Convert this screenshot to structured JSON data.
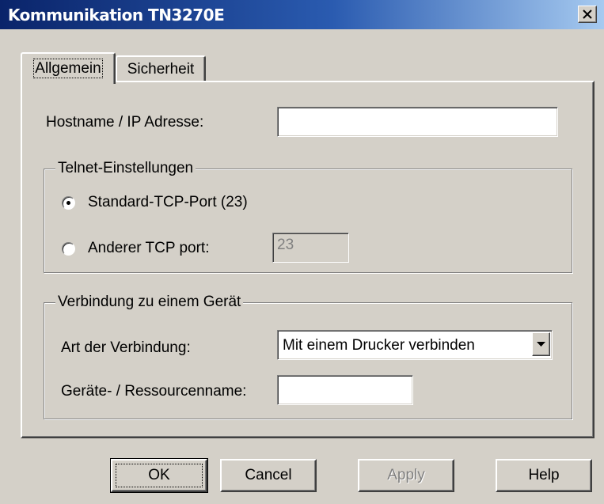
{
  "window": {
    "title": "Kommunikation TN3270E",
    "close_icon": "close-x-icon"
  },
  "tabs": [
    {
      "label": "Allgemein",
      "active": true
    },
    {
      "label": "Sicherheit",
      "active": false
    }
  ],
  "hostname": {
    "label": "Hostname / IP Adresse:",
    "value": ""
  },
  "telnet": {
    "legend": "Telnet-Einstellungen",
    "standard_port_label": "Standard-TCP-Port (23)",
    "standard_port_selected": true,
    "other_port_label": "Anderer TCP port:",
    "other_port_selected": false,
    "other_port_value": "23"
  },
  "device": {
    "legend": "Verbindung zu einem Gerät",
    "connection_type_label": "Art der Verbindung:",
    "connection_type_value": "Mit einem Drucker verbinden",
    "resource_name_label": "Geräte- / Ressourcenname:",
    "resource_name_value": ""
  },
  "buttons": {
    "ok": "OK",
    "cancel": "Cancel",
    "apply": "Apply",
    "help": "Help"
  }
}
